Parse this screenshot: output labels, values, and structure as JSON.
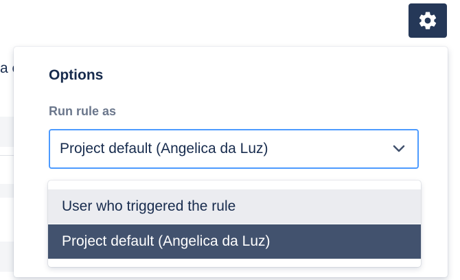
{
  "toolbar": {
    "settings_icon": "gear-icon"
  },
  "background": {
    "fragment_text": "a c"
  },
  "options": {
    "title": "Options",
    "run_rule_label": "Run rule as",
    "selected_value": "Project default (Angelica da Luz)",
    "chevron_icon": "chevron-down-icon",
    "menu": [
      {
        "label": "User who triggered the rule",
        "state": "hover"
      },
      {
        "label": "Project default (Angelica da Luz)",
        "state": "selected"
      }
    ]
  },
  "colors": {
    "button_bg": "#253858",
    "focus_border": "#4c9aff",
    "selected_item_bg": "#42526e",
    "hover_item_bg": "#ebecf0",
    "title_text": "#172b4d",
    "label_text": "#6b778c"
  }
}
